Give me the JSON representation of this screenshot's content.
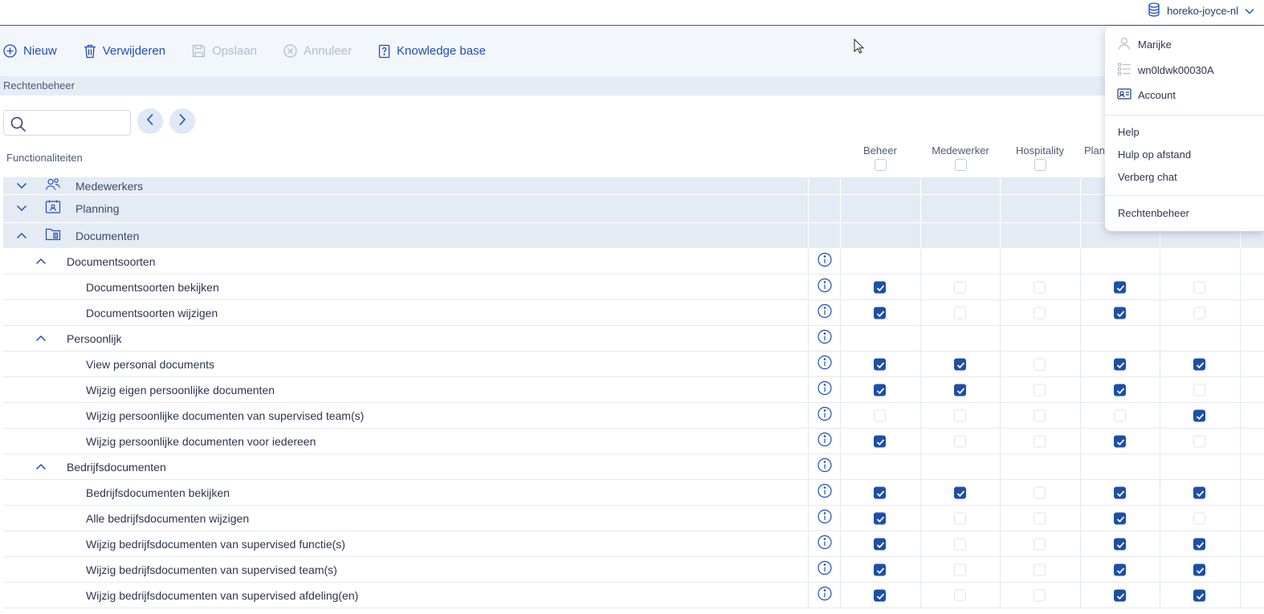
{
  "header": {
    "tenant": "horeko-joyce-nl",
    "icons": {
      "tenant": "database-icon",
      "expand": "chevron-down-icon"
    }
  },
  "toolbar": {
    "new_label": "Nieuw",
    "delete_label": "Verwijderen",
    "save_label": "Opslaan",
    "cancel_label": "Annuleer",
    "kb_label": "Knowledge base"
  },
  "breadcrumb": "Rechtenbeheer",
  "search": {
    "value": "",
    "placeholder": ""
  },
  "table": {
    "functions_label": "Functionaliteiten",
    "columns": [
      "Beheer",
      "Medewerker",
      "Hospitality",
      "Plan",
      ""
    ],
    "categories": [
      {
        "label": "Medewerkers",
        "icon": "employees-icon",
        "expanded": false
      },
      {
        "label": "Planning",
        "icon": "planning-icon",
        "expanded": false
      },
      {
        "label": "Documenten",
        "icon": "folder-icon",
        "expanded": true
      }
    ],
    "groups": [
      {
        "label": "Documentsoorten",
        "items": [
          {
            "label": "Documentsoorten bekijken",
            "values": [
              true,
              false,
              false,
              true,
              false
            ]
          },
          {
            "label": "Documentsoorten wijzigen",
            "values": [
              true,
              false,
              false,
              true,
              false
            ]
          }
        ]
      },
      {
        "label": "Persoonlijk",
        "items": [
          {
            "label": "View personal documents",
            "values": [
              true,
              true,
              false,
              true,
              true
            ]
          },
          {
            "label": "Wijzig eigen persoonlijke documenten",
            "values": [
              true,
              true,
              false,
              true,
              false
            ]
          },
          {
            "label": "Wijzig persoonlijke documenten van supervised team(s)",
            "values": [
              false,
              false,
              false,
              false,
              true
            ]
          },
          {
            "label": "Wijzig persoonlijke documenten voor iedereen",
            "values": [
              true,
              false,
              false,
              true,
              false
            ]
          }
        ]
      },
      {
        "label": "Bedrijfsdocumenten",
        "items": [
          {
            "label": "Bedrijfsdocumenten bekijken",
            "values": [
              true,
              true,
              false,
              true,
              true
            ]
          },
          {
            "label": "Alle bedrijfsdocumenten wijzigen",
            "values": [
              true,
              false,
              false,
              true,
              false
            ]
          },
          {
            "label": "Wijzig bedrijfsdocumenten van supervised functie(s)",
            "values": [
              true,
              false,
              false,
              true,
              true
            ]
          },
          {
            "label": "Wijzig bedrijfsdocumenten van supervised team(s)",
            "values": [
              true,
              false,
              false,
              true,
              true
            ]
          },
          {
            "label": "Wijzig bedrijfsdocumenten van supervised afdeling(en)",
            "values": [
              true,
              false,
              false,
              true,
              true
            ]
          }
        ]
      }
    ]
  },
  "user_menu": {
    "user": "Marijke",
    "code": "wn0ldwk00030A",
    "account": "Account",
    "help": "Help",
    "remote_help": "Hulp op afstand",
    "hide_chat": "Verberg chat",
    "rights": "Rechtenbeheer"
  },
  "colors": {
    "accent": "#1d4fb5",
    "checked": "#1c4fa8",
    "category_bg": "#e5ebf4",
    "toolbar_bg": "#f3f6fa"
  }
}
